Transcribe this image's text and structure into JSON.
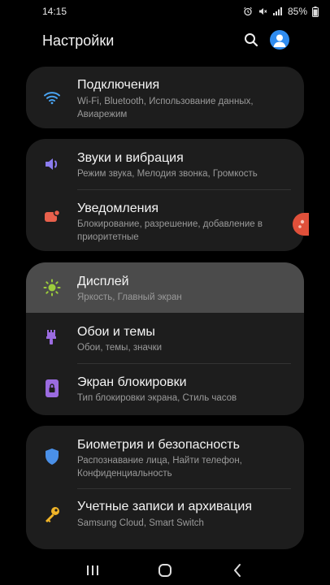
{
  "status_bar": {
    "time": "14:15",
    "battery": "85%",
    "icons": [
      "alarm-icon",
      "mute-icon",
      "signal-icon",
      "battery-icon"
    ]
  },
  "header": {
    "title": "Настройки",
    "icons": [
      "search-icon",
      "profile-icon"
    ]
  },
  "cards": [
    {
      "items": [
        {
          "icon": "wifi-icon",
          "title": "Подключения",
          "subtitle": "Wi-Fi, Bluetooth, Использование данных, Авиарежим"
        }
      ]
    },
    {
      "items": [
        {
          "icon": "sound-icon",
          "title": "Звуки и вибрация",
          "subtitle": "Режим звука, Мелодия звонка, Громкость"
        },
        {
          "icon": "notifications-icon",
          "title": "Уведомления",
          "subtitle": "Блокирование, разрешение, добавление в приоритетные"
        }
      ]
    },
    {
      "items": [
        {
          "icon": "display-sun-icon",
          "title": "Дисплей",
          "subtitle": "Яркость, Главный экран",
          "highlighted": true
        },
        {
          "icon": "brush-icon",
          "title": "Обои и темы",
          "subtitle": "Обои, темы, значки"
        },
        {
          "icon": "lock-screen-icon",
          "title": "Экран блокировки",
          "subtitle": "Тип блокировки экрана, Стиль часов"
        }
      ]
    },
    {
      "items": [
        {
          "icon": "shield-icon",
          "title": "Биометрия и безопасность",
          "subtitle": "Распознавание лица, Найти телефон, Конфиденциальность"
        },
        {
          "icon": "key-icon",
          "title": "Учетные записи и архивация",
          "subtitle": "Samsung Cloud, Smart Switch"
        }
      ]
    }
  ],
  "nav_bar": {
    "buttons": [
      "recent-apps-icon",
      "home-icon",
      "back-icon"
    ]
  },
  "colors": {
    "background": "#000000",
    "card": "#1d1d1d",
    "highlight": "#4b4b4b",
    "accent_blue": "#2f8cf0",
    "wifi": "#4aa3f0",
    "sound": "#8b7cf0",
    "notifications": "#e8604c",
    "display": "#9ccc3c",
    "themes": "#9b6be0",
    "lock": "#9b6be0",
    "security": "#4a90e8",
    "accounts": "#f0b428"
  }
}
